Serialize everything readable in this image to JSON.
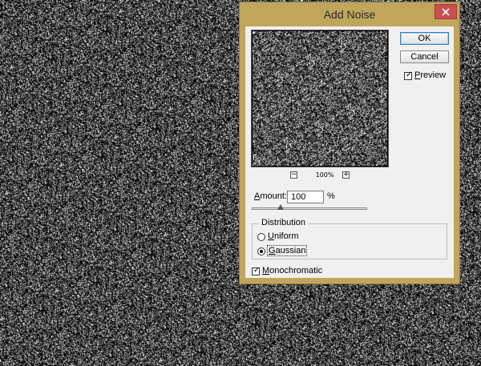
{
  "dialog": {
    "title": "Add Noise",
    "ok_label": "OK",
    "cancel_label": "Cancel",
    "preview_label": "Preview",
    "preview_checked": true,
    "zoom": {
      "level": "100%",
      "zoom_out_symbol": "−",
      "zoom_in_symbol": "+"
    },
    "amount": {
      "label": "Amount:",
      "value": "100",
      "unit": "%",
      "slider_fraction": 0.25
    },
    "distribution": {
      "legend": "Distribution",
      "options": [
        "Uniform",
        "Gaussian"
      ],
      "selected": "Gaussian"
    },
    "monochromatic_label": "Monochromatic",
    "monochromatic_checked": true
  },
  "icons": {
    "close": "close-icon",
    "check": "checkmark-icon"
  },
  "colors": {
    "title_bar": "#bfa65a",
    "close_button": "#c75050",
    "dialog_body": "#f0f0f0"
  }
}
